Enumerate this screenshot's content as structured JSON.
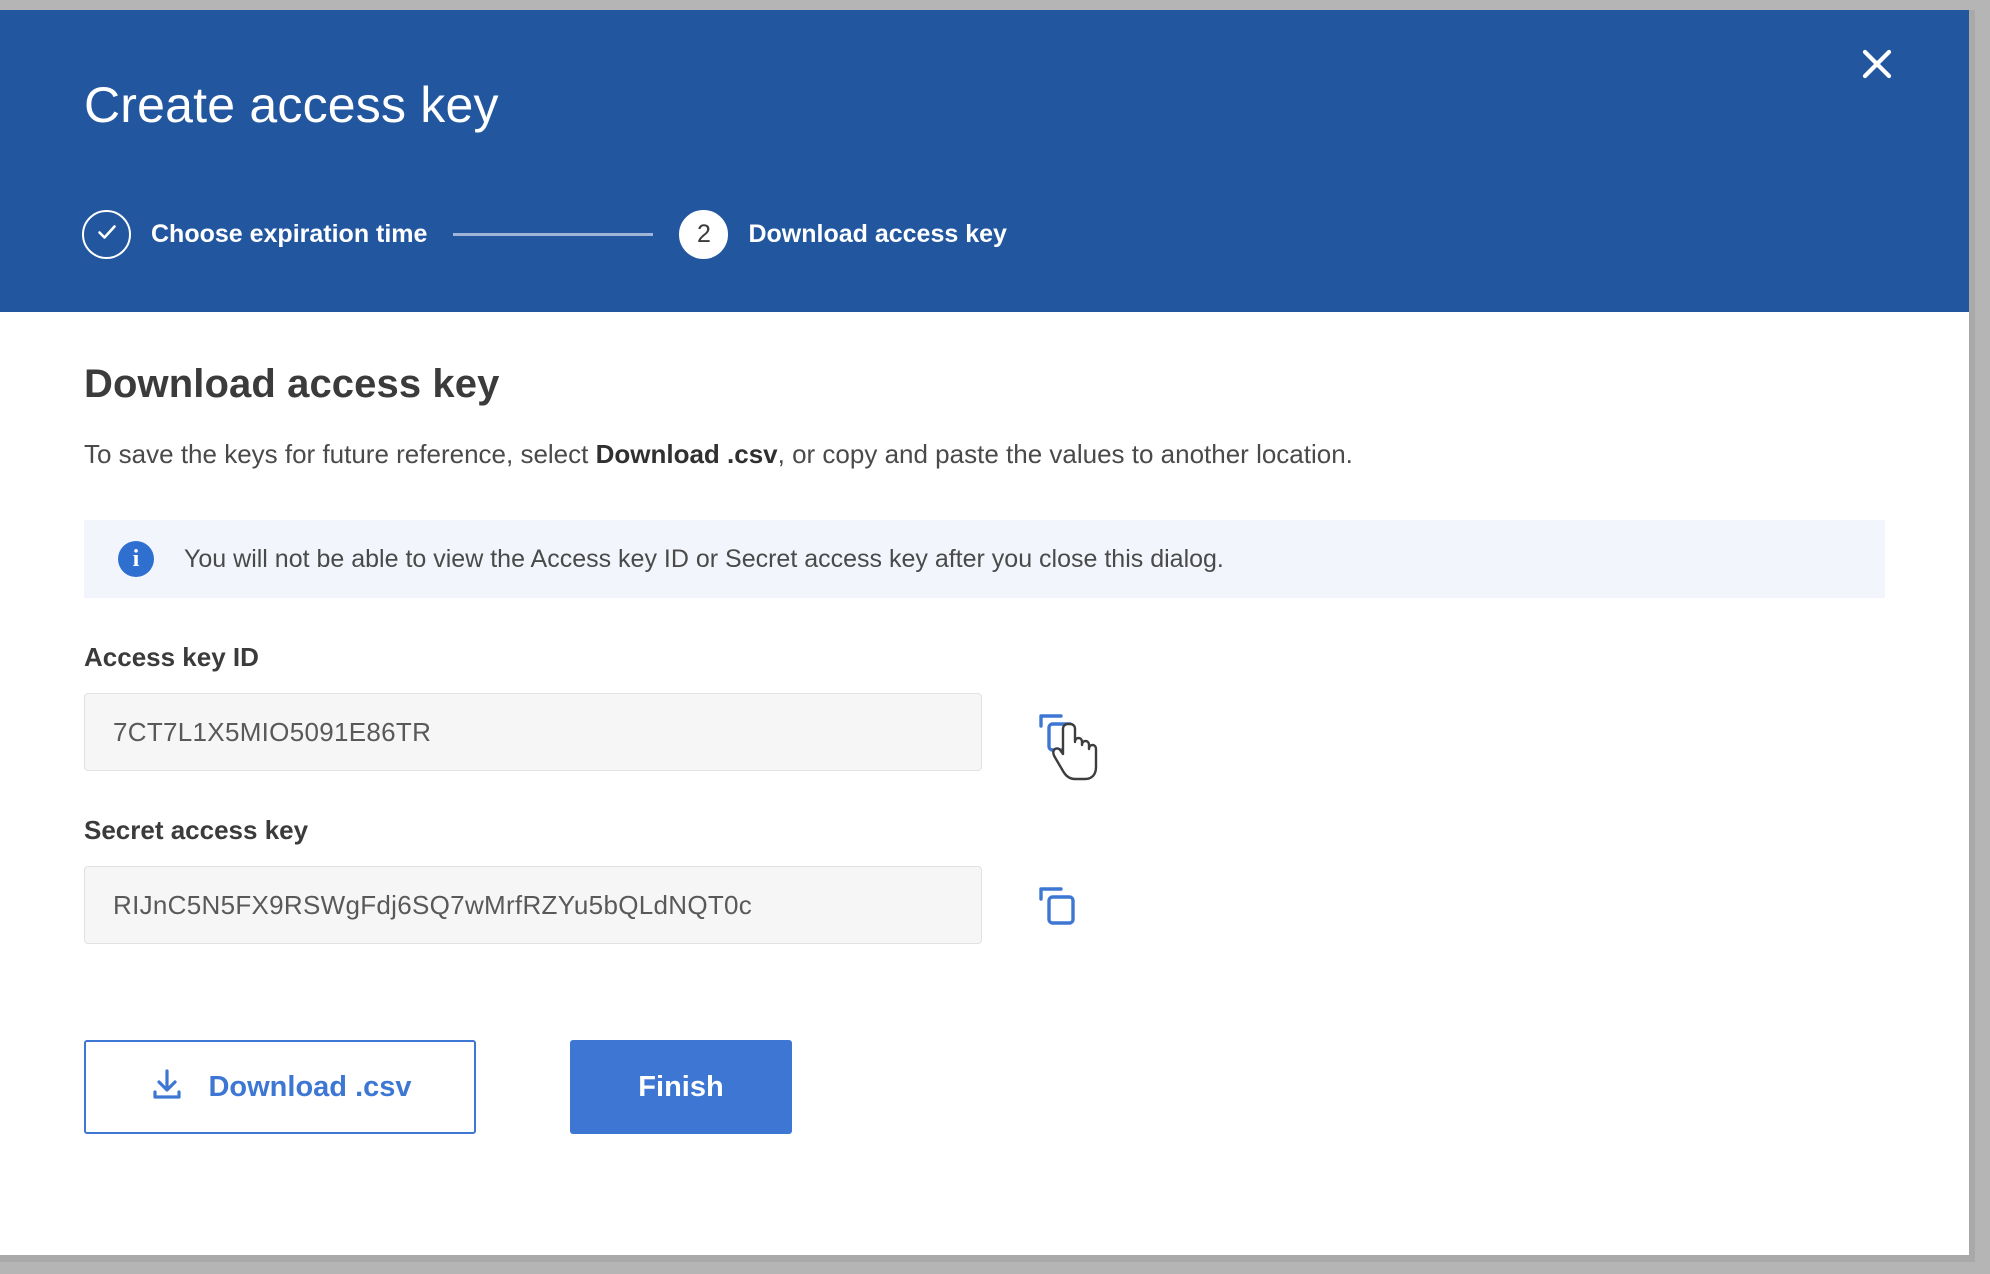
{
  "colors": {
    "header_blue": "#22579f",
    "accent_blue": "#3d77d3",
    "alert_bg": "#f2f6fc",
    "field_bg": "#f6f6f6",
    "text_dark": "#3b3b3b"
  },
  "dialog": {
    "title": "Create access key",
    "close_icon": "close-icon",
    "close_label": "Close"
  },
  "stepper": {
    "steps": [
      {
        "id": "choose-expiration-time",
        "label": "Choose expiration time",
        "state": "completed",
        "marker": "check-icon"
      },
      {
        "id": "download-access-key",
        "label": "Download access key",
        "state": "current",
        "marker": "2"
      }
    ]
  },
  "main": {
    "heading": "Download access key",
    "description_before": "To save the keys for future reference, select ",
    "description_emphasis": "Download .csv",
    "description_after": ", or copy and paste the values to another location.",
    "alert": {
      "icon": "info-icon",
      "icon_glyph": "i",
      "text": "You will not be able to view the Access key ID or Secret access key after you close this dialog."
    },
    "fields": [
      {
        "id": "access-key-id",
        "label": "Access key ID",
        "value": "7CT7L1X5MIO5091E86TR",
        "copy_icon": "copy-icon",
        "copy_label": "Copy Access key ID",
        "cursor_over": true
      },
      {
        "id": "secret-access-key",
        "label": "Secret access key",
        "value": "RIJnC5N5FX9RSWgFdj6SQ7wMrfRZYu5bQLdNQT0c",
        "copy_icon": "copy-icon",
        "copy_label": "Copy Secret access key",
        "cursor_over": false
      }
    ]
  },
  "actions": {
    "download_icon": "download-icon",
    "download_label": "Download .csv",
    "finish_label": "Finish"
  }
}
